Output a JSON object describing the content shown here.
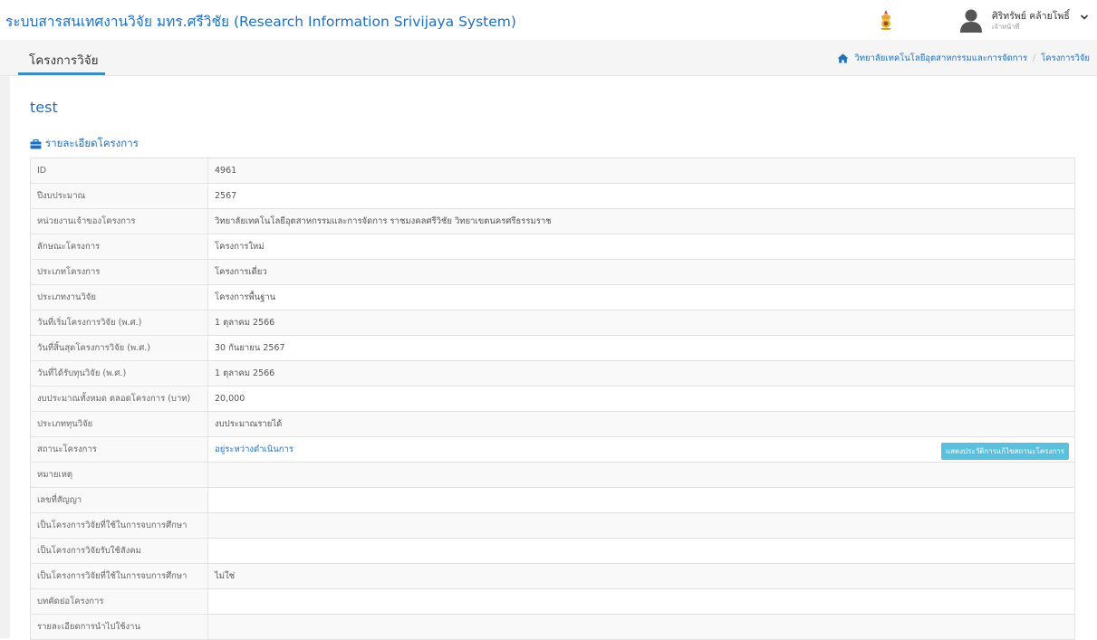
{
  "app": {
    "title": "ระบบสารสนเทศงานวิจัย มทร.ศรีวิชัย (Research Information Srivijaya System)"
  },
  "user": {
    "name": "ศิริทรัพย์ คล้ายโพธิ์",
    "role": "เจ้าหน้าที่"
  },
  "header": {
    "page_title": "โครงการวิจัย",
    "breadcrumb": [
      "วิทยาลัยเทคโนโลยีอุตสาหกรรมและการจัดการ",
      "โครงการวิจัย"
    ],
    "separator": "/"
  },
  "project": {
    "title": "test",
    "section_title": "รายละเอียดโครงการ"
  },
  "details": {
    "rows": [
      {
        "label": "ID",
        "value": "4961"
      },
      {
        "label": "ปีงบประมาณ",
        "value": "2567"
      },
      {
        "label": "หน่วยงานเจ้าของโครงการ",
        "value": "วิทยาลัยเทคโนโลยีอุตสาหกรรมและการจัดการ ราชมงคลศรีวิชัย วิทยาเขตนครศรีธรรมราช"
      },
      {
        "label": "ลักษณะโครงการ",
        "value": "โครงการใหม่"
      },
      {
        "label": "ประเภทโครงการ",
        "value": "โครงการเดี่ยว"
      },
      {
        "label": "ประเภทงานวิจัย",
        "value": "โครงการพื้นฐาน"
      },
      {
        "label": "วันที่เริ่มโครงการวิจัย (พ.ศ.)",
        "value": "1 ตุลาคม 2566"
      },
      {
        "label": "วันที่สิ้นสุดโครงการวิจัย (พ.ศ.)",
        "value": "30 กันยายน 2567"
      },
      {
        "label": "วันที่ได้รับทุนวิจัย (พ.ศ.)",
        "value": "1 ตุลาคม 2566"
      },
      {
        "label": "งบประมาณทั้งหมด ตลอดโครงการ (บาท)",
        "value": "20,000"
      },
      {
        "label": "ประเภททุนวิจัย",
        "value": "งบประมาณรายได้"
      },
      {
        "label": "สถานะโครงการ",
        "value": "อยู่ระหว่างดำเนินการ"
      },
      {
        "label": "หมายเหตุ",
        "value": ""
      },
      {
        "label": "เลขที่สัญญา",
        "value": ""
      },
      {
        "label": "เป็นโครงการวิจัยที่ใช้ในการจบการศึกษา",
        "value": ""
      },
      {
        "label": "เป็นโครงการวิจัยรับใช้สังคม",
        "value": ""
      },
      {
        "label": "เป็นโครงการวิจัยที่ใช้ในการจบการศึกษา",
        "value": "ไม่ใช่"
      },
      {
        "label": "บทคัดย่อโครงการ",
        "value": ""
      },
      {
        "label": "รายละเอียดการนำไปใช้งาน",
        "value": ""
      }
    ],
    "history_button": "แสดงประวัติการแก้ไขสถานะโครงการ"
  },
  "colors": {
    "accent": "#1f6fbf",
    "tab_underline": "#3c8dbc",
    "info_button": "#5bc0de"
  },
  "icons": {
    "home": "home-icon",
    "briefcase": "briefcase-icon",
    "user": "user-icon",
    "chevron": "chevron-down-icon",
    "logo": "university-logo-icon"
  }
}
